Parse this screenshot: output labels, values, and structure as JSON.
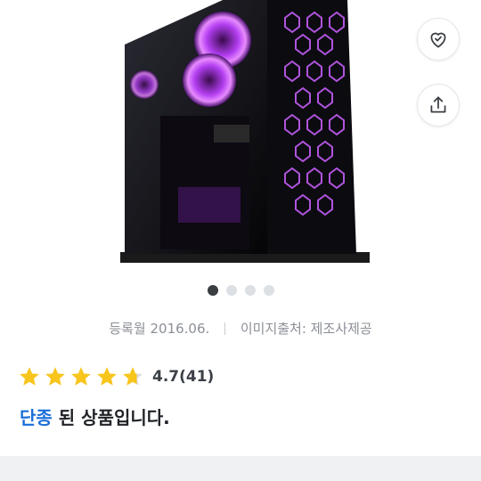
{
  "product": {
    "image_alt": "PC case with purple LED fans",
    "carousel": {
      "count": 4,
      "active_index": 0
    },
    "registered": "등록월 2016.06.",
    "image_source": "이미지출처: 제조사제공",
    "rating": {
      "value": 4.7,
      "value_text": "4.7",
      "count_text": "(41)"
    },
    "status": {
      "highlight": "단종",
      "rest": " 된 상품입니다."
    }
  },
  "actions": {
    "wishlist_icon": "heart-check-icon",
    "share_icon": "share-icon"
  },
  "colors": {
    "accent_blue": "#1a6ed8",
    "star_yellow": "#f7c51c"
  }
}
